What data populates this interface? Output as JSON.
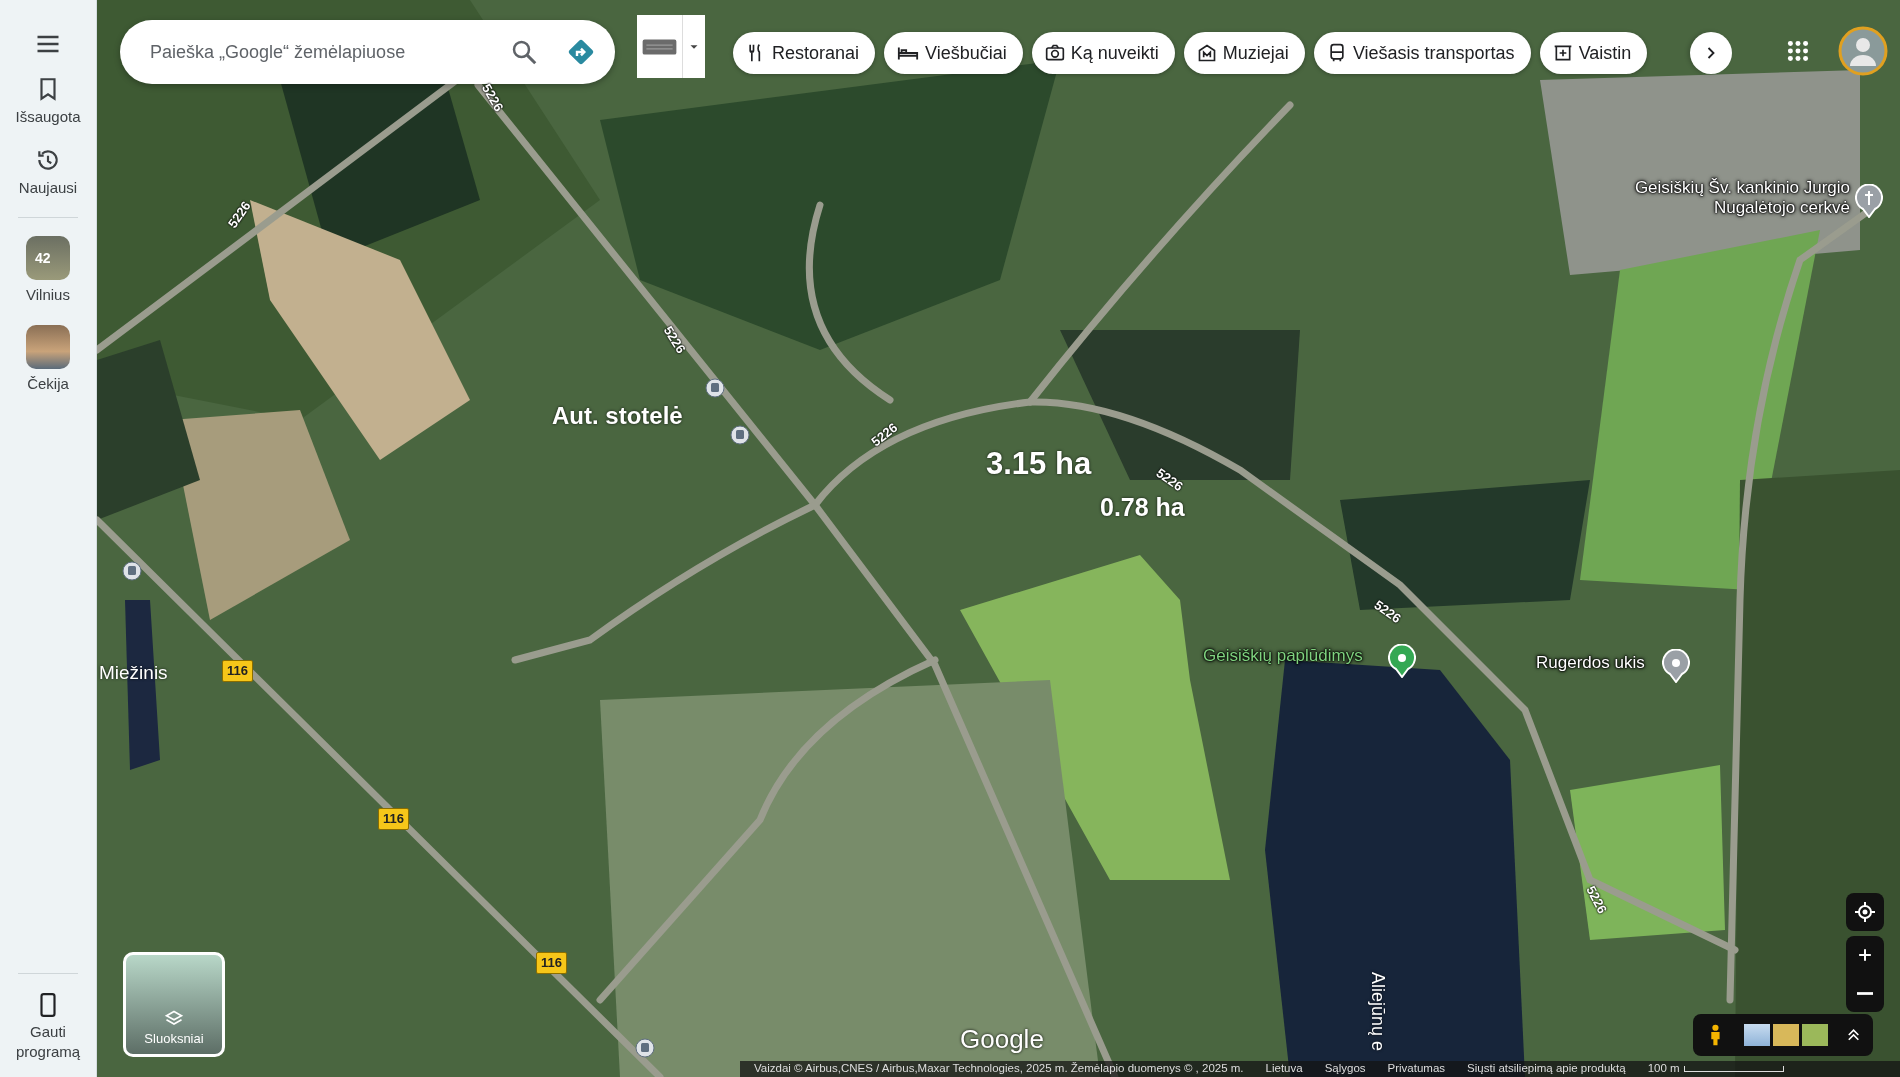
{
  "sidebar": {
    "items": [
      {
        "label": "Išsaugota",
        "kind": "saved"
      },
      {
        "label": "Naujausi",
        "kind": "recent"
      }
    ],
    "places": [
      {
        "label": "Vilnius",
        "count": "42"
      },
      {
        "label": "Čekija"
      }
    ],
    "get_app": "Gauti programą"
  },
  "search": {
    "placeholder": "Paieška „Google“ žemėlapiuose"
  },
  "chips": [
    {
      "label": "Restoranai",
      "kind": "restaurant"
    },
    {
      "label": "Viešbučiai",
      "kind": "hotel"
    },
    {
      "label": "Ką nuveikti",
      "kind": "camera"
    },
    {
      "label": "Muziejai",
      "kind": "museum"
    },
    {
      "label": "Viešasis transportas",
      "kind": "transit"
    },
    {
      "label": "Vaistin",
      "kind": "pharmacy"
    }
  ],
  "map": {
    "labels": [
      {
        "text": "Aut. stotelė",
        "kind": "annotation"
      },
      {
        "text": "3.15 ha",
        "kind": "annotation"
      },
      {
        "text": "0.78 ha",
        "kind": "annotation"
      },
      {
        "text": "Miežinis",
        "kind": "place"
      },
      {
        "text": "Aliejūnų e",
        "kind": "water"
      }
    ],
    "pois": [
      {
        "text": "Geisiškių Šv. kankinio Jurgio Nugalėtojo cerkvė",
        "kind": "church",
        "color": "#9aa0a6"
      },
      {
        "text": "Geisiškių paplūdimys",
        "kind": "beach",
        "color": "#34a853"
      },
      {
        "text": "Rugerdos ukis",
        "kind": "place",
        "color": "#9aa0a6"
      }
    ],
    "road_shields": [
      {
        "text": "5226",
        "kind": "regional"
      },
      {
        "text": "5226",
        "kind": "regional"
      },
      {
        "text": "5226",
        "kind": "regional"
      },
      {
        "text": "5226",
        "kind": "regional"
      },
      {
        "text": "5226",
        "kind": "regional"
      },
      {
        "text": "5226",
        "kind": "regional"
      },
      {
        "text": "5226",
        "kind": "regional"
      },
      {
        "text": "116",
        "kind": "national"
      },
      {
        "text": "116",
        "kind": "national"
      },
      {
        "text": "116",
        "kind": "national"
      }
    ],
    "layers_button": "Sluoksniai",
    "logo": "Google"
  },
  "footer": {
    "attribution": "Vaizdai © Airbus,CNES / Airbus,Maxar Technologies, 2025 m. Žemėlapio duomenys © , 2025 m.",
    "links": [
      "Lietuva",
      "Sąlygos",
      "Privatumas",
      "Siųsti atsiliepimą apie produktą"
    ],
    "scale": "100 m"
  }
}
